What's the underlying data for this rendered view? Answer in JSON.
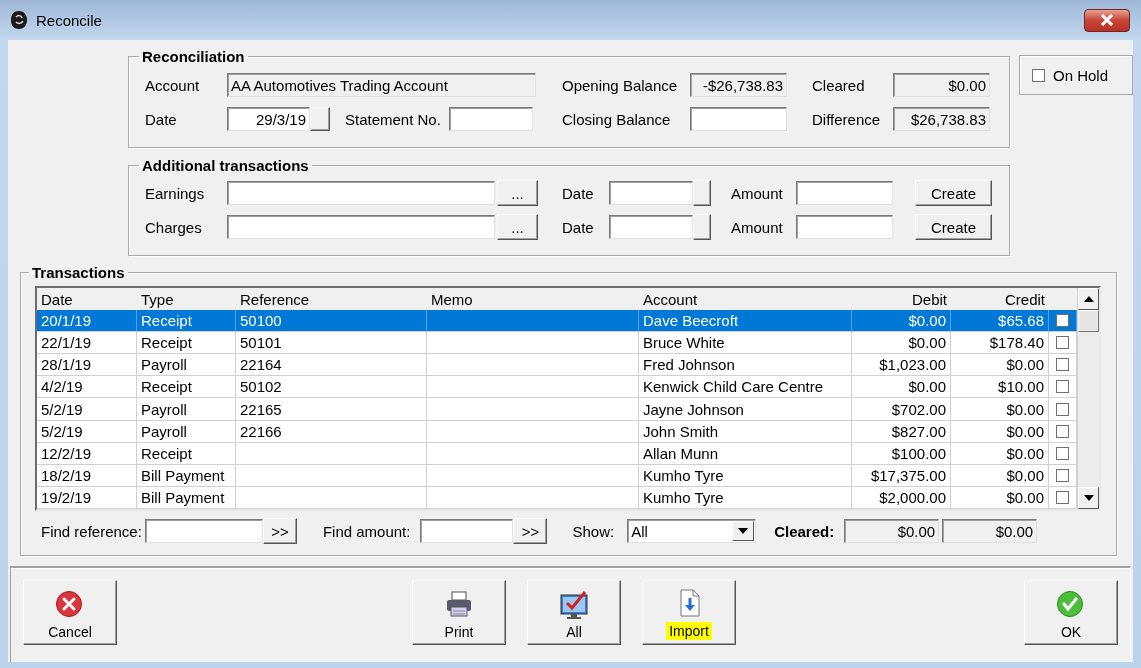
{
  "window": {
    "title": "Reconcile"
  },
  "reconciliation": {
    "title": "Reconciliation",
    "account": {
      "label": "Account",
      "value": "AA Automotives Trading Account"
    },
    "date": {
      "label": "Date",
      "value": "29/3/19"
    },
    "statement_no": {
      "label": "Statement No."
    },
    "opening_balance": {
      "label": "Opening Balance",
      "value": "-$26,738.83"
    },
    "closing_balance": {
      "label": "Closing Balance"
    },
    "cleared": {
      "label": "Cleared",
      "value": "$0.00"
    },
    "difference": {
      "label": "Difference",
      "value": "$26,738.83"
    }
  },
  "on_hold": {
    "label": "On Hold",
    "checked": false
  },
  "additional_transactions": {
    "title": "Additional transactions",
    "rows": [
      {
        "label": "Earnings",
        "browse_button": "...",
        "date_label": "Date",
        "amount_label": "Amount",
        "create_button": "Create"
      },
      {
        "label": "Charges",
        "browse_button": "...",
        "date_label": "Date",
        "amount_label": "Amount",
        "create_button": "Create"
      }
    ]
  },
  "transactions": {
    "title": "Transactions",
    "columns": [
      "Date",
      "Type",
      "Reference",
      "Memo",
      "Account",
      "Debit",
      "Credit"
    ],
    "rows": [
      {
        "date": "20/1/19",
        "type": "Receipt",
        "reference": "50100",
        "account": "Dave Beecroft",
        "debit": "$0.00",
        "credit": "$65.68",
        "cleared": false,
        "selected": true
      },
      {
        "date": "22/1/19",
        "type": "Receipt",
        "reference": "50101",
        "account": "Bruce White",
        "debit": "$0.00",
        "credit": "$178.40",
        "cleared": false,
        "selected": false
      },
      {
        "date": "28/1/19",
        "type": "Payroll",
        "reference": "22164",
        "account": "Fred Johnson",
        "debit": "$1,023.00",
        "credit": "$0.00",
        "cleared": false,
        "selected": false
      },
      {
        "date": "4/2/19",
        "type": "Receipt",
        "reference": "50102",
        "account": "Kenwick Child Care Centre",
        "debit": "$0.00",
        "credit": "$10.00",
        "cleared": false,
        "selected": false
      },
      {
        "date": "5/2/19",
        "type": "Payroll",
        "reference": "22165",
        "account": "Jayne Johnson",
        "debit": "$702.00",
        "credit": "$0.00",
        "cleared": false,
        "selected": false
      },
      {
        "date": "5/2/19",
        "type": "Payroll",
        "reference": "22166",
        "account": "John Smith",
        "debit": "$827.00",
        "credit": "$0.00",
        "cleared": false,
        "selected": false
      },
      {
        "date": "12/2/19",
        "type": "Receipt",
        "account": "Allan Munn",
        "debit": "$100.00",
        "credit": "$0.00",
        "cleared": false,
        "selected": false
      },
      {
        "date": "18/2/19",
        "type": "Bill Payment",
        "account": "Kumho Tyre",
        "debit": "$17,375.00",
        "credit": "$0.00",
        "cleared": false,
        "selected": false
      },
      {
        "date": "19/2/19",
        "type": "Bill Payment",
        "account": "Kumho Tyre",
        "debit": "$2,000.00",
        "credit": "$0.00",
        "cleared": false,
        "selected": false
      }
    ],
    "find_reference": {
      "label": "Find reference:",
      "button": ">>"
    },
    "find_amount": {
      "label": "Find amount:",
      "button": ">>"
    },
    "show": {
      "label": "Show:",
      "value": "All"
    },
    "cleared": {
      "label": "Cleared:",
      "debit": "$0.00",
      "credit": "$0.00"
    }
  },
  "toolbar": {
    "left": [
      {
        "label": "Cancel",
        "kind": "cancel",
        "highlighted": false
      }
    ],
    "center": [
      {
        "label": "Print",
        "kind": "print",
        "highlighted": false
      },
      {
        "label": "All",
        "kind": "all",
        "highlighted": false
      },
      {
        "label": "Import",
        "kind": "import",
        "highlighted": true
      }
    ],
    "right": [
      {
        "label": "OK",
        "kind": "ok",
        "highlighted": false
      }
    ]
  }
}
